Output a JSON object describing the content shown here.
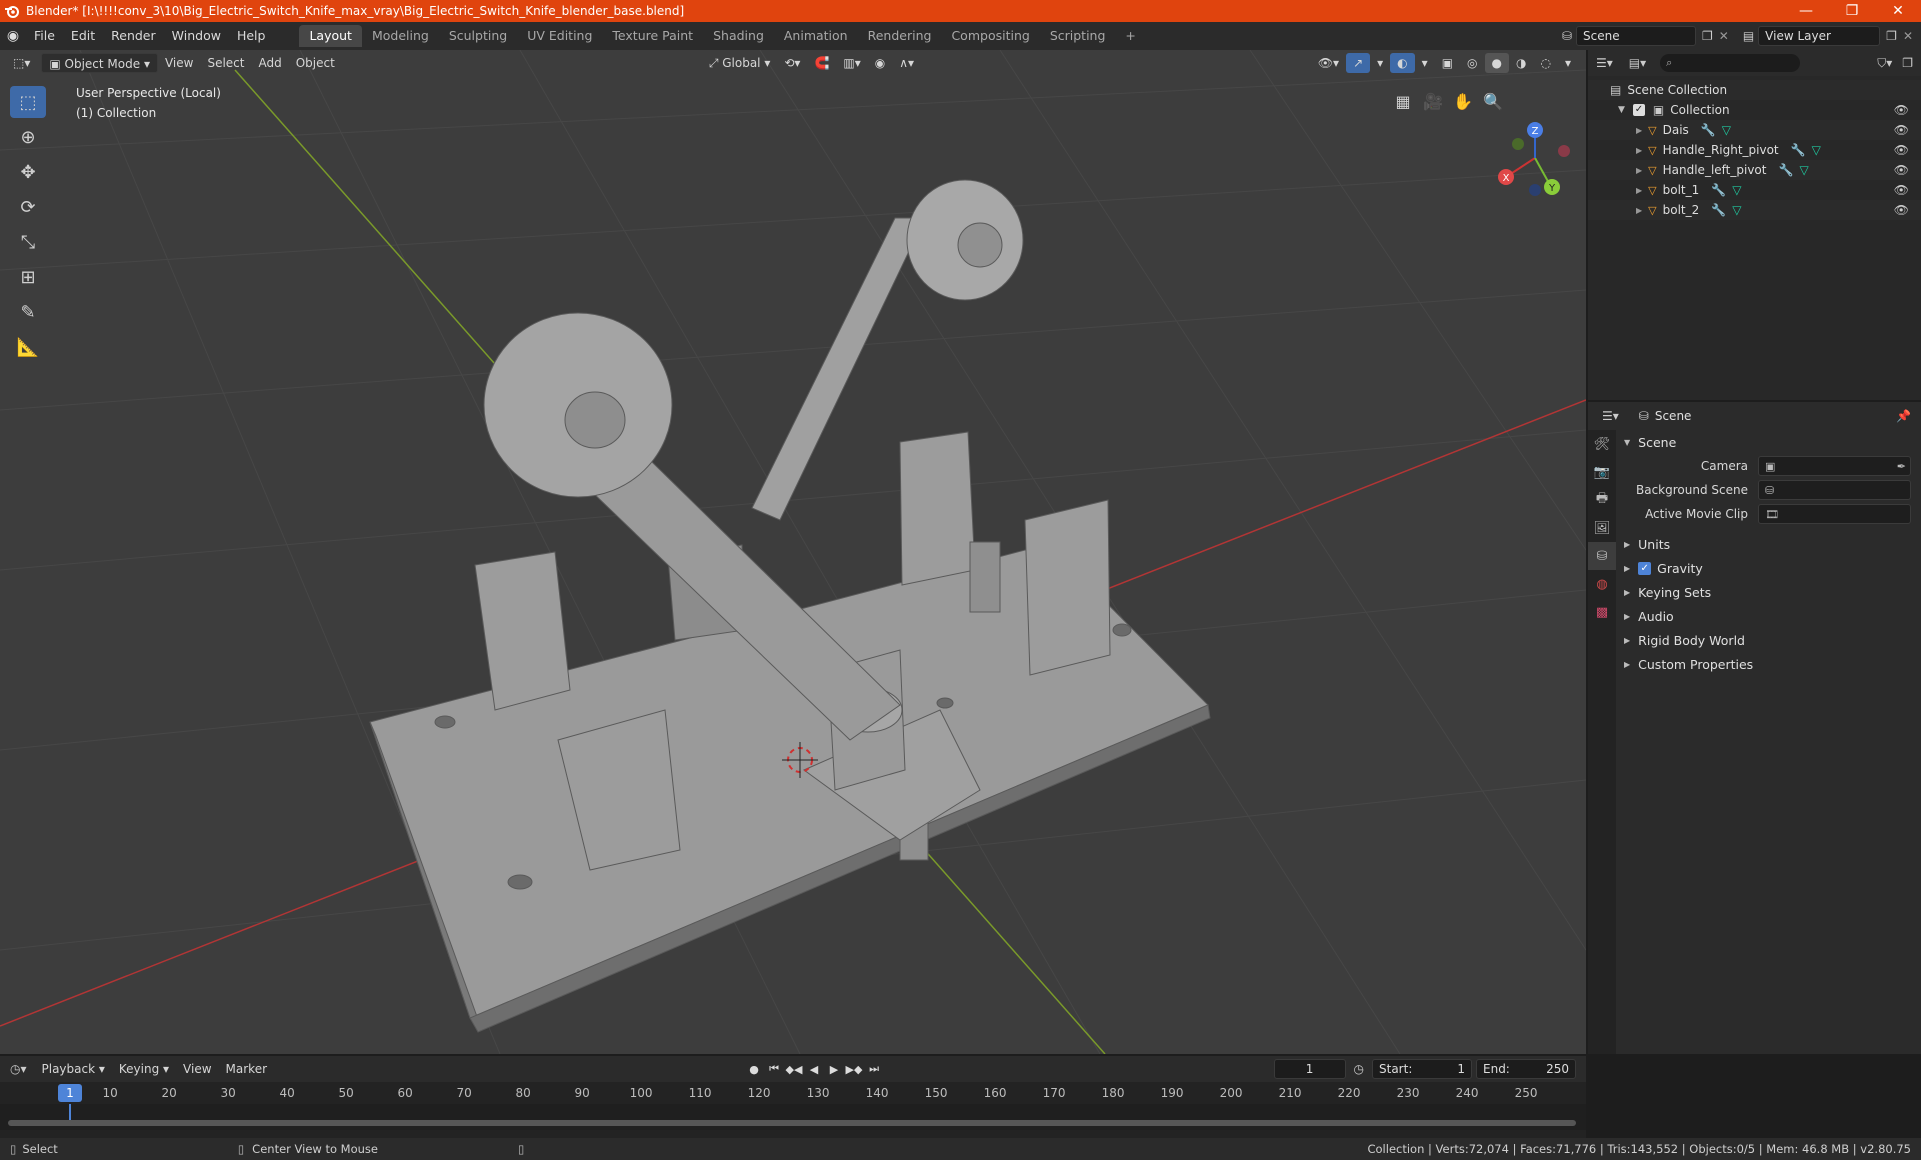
{
  "window": {
    "title": "Blender* [I:\\!!!!conv_3\\10\\Big_Electric_Switch_Knife_max_vray\\Big_Electric_Switch_Knife_blender_base.blend]",
    "minimize": "—",
    "maximize": "❐",
    "close": "✕"
  },
  "menu": [
    "File",
    "Edit",
    "Render",
    "Window",
    "Help"
  ],
  "workspaces": [
    "Layout",
    "Modeling",
    "Sculpting",
    "UV Editing",
    "Texture Paint",
    "Shading",
    "Animation",
    "Rendering",
    "Compositing",
    "Scripting"
  ],
  "workspace_add": "+",
  "scene_field": "Scene",
  "view_layer_field": "View Layer",
  "viewport": {
    "mode": "Object Mode",
    "menus": [
      "View",
      "Select",
      "Add",
      "Object"
    ],
    "transform_orientation": "Global",
    "perspective_label": "User Perspective (Local)",
    "collection_label": "(1) Collection",
    "gizmo": {
      "x": "X",
      "y": "Y",
      "z": "Z"
    }
  },
  "outliner": {
    "root": "Scene Collection",
    "collection": "Collection",
    "objects": [
      "Dais",
      "Handle_Right_pivot",
      "Handle_left_pivot",
      "bolt_1",
      "bolt_2"
    ]
  },
  "properties": {
    "header": "Scene",
    "panel": "Scene",
    "fields": [
      {
        "label": "Camera"
      },
      {
        "label": "Background Scene"
      },
      {
        "label": "Active Movie Clip"
      }
    ],
    "subpanels": [
      "Units",
      "Gravity",
      "Keying Sets",
      "Audio",
      "Rigid Body World",
      "Custom Properties"
    ],
    "gravity_checked": true
  },
  "timeline": {
    "menus": [
      "Playback",
      "Keying",
      "View",
      "Marker"
    ],
    "current_frame": "1",
    "start_label": "Start:",
    "start": "1",
    "end_label": "End:",
    "end": "250",
    "ticks": [
      "1",
      "10",
      "20",
      "30",
      "40",
      "50",
      "60",
      "70",
      "80",
      "90",
      "100",
      "110",
      "120",
      "130",
      "140",
      "150",
      "160",
      "170",
      "180",
      "190",
      "200",
      "210",
      "220",
      "230",
      "240",
      "250"
    ]
  },
  "status": {
    "left": "Select",
    "middle": "Center View to Mouse",
    "right": "Collection | Verts:72,074 | Faces:71,776 | Tris:143,552 | Objects:0/5 | Mem: 46.8 MB | v2.80.75"
  }
}
